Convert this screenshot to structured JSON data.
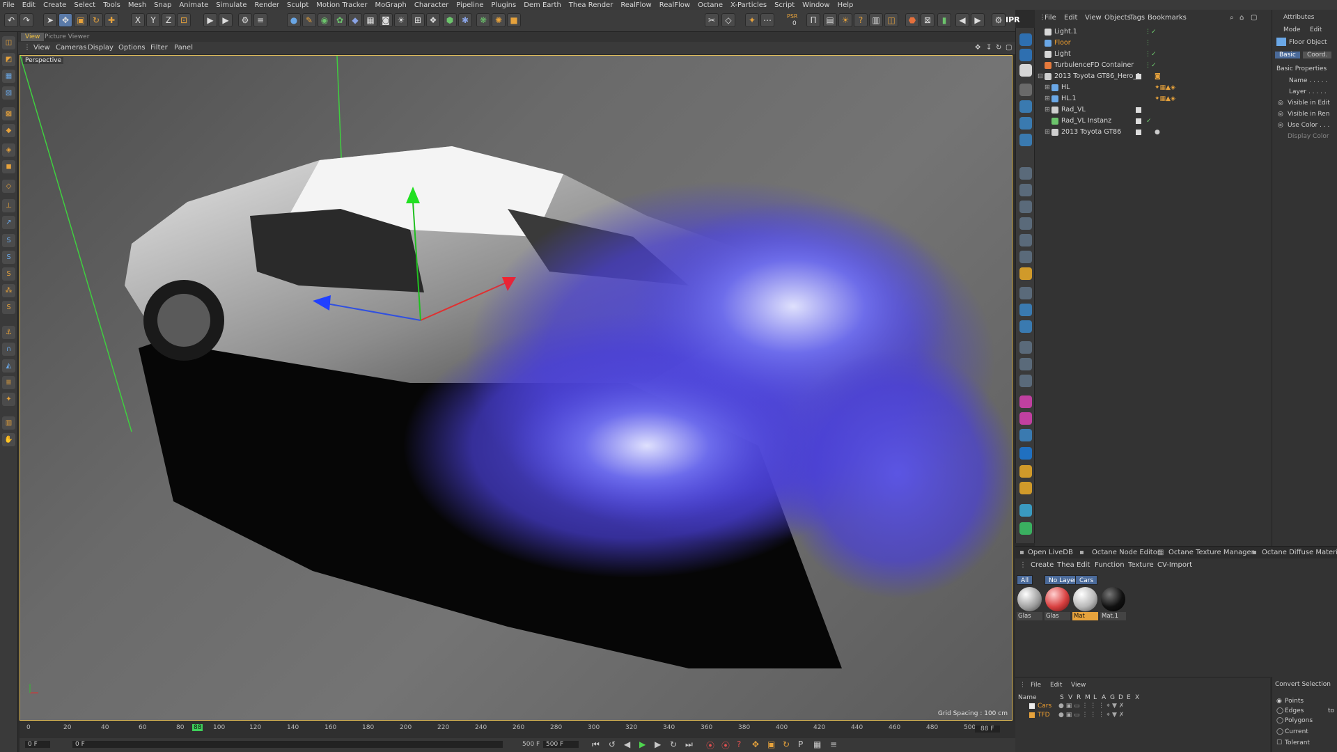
{
  "menu": [
    "File",
    "Edit",
    "Create",
    "Select",
    "Tools",
    "Mesh",
    "Snap",
    "Animate",
    "Simulate",
    "Render",
    "Sculpt",
    "Motion Tracker",
    "MoGraph",
    "Character",
    "Pipeline",
    "Plugins",
    "Dem Earth",
    "Thea Render",
    "RealFlow",
    "RealFlow",
    "Octane",
    "X-Particles",
    "Script",
    "Window",
    "Help"
  ],
  "toolbar": {
    "axis_x": "X",
    "axis_y": "Y",
    "axis_z": "Z",
    "psr_label": "PSR",
    "psr_value": "0",
    "ipr_label": "IPR"
  },
  "viewport": {
    "tab_view": "View",
    "tab_picture_viewer": "Picture Viewer",
    "menu": [
      "View",
      "Cameras",
      "Display",
      "Options",
      "Filter",
      "Panel"
    ],
    "camera_label": "Perspective",
    "grid_spacing": "Grid Spacing : 100 cm"
  },
  "timeline": {
    "ticks": [
      "0",
      "20",
      "40",
      "60",
      "80",
      "88",
      "100",
      "120",
      "140",
      "160",
      "180",
      "200",
      "220",
      "240",
      "260",
      "280",
      "300",
      "320",
      "340",
      "360",
      "380",
      "400",
      "420",
      "440",
      "460",
      "480",
      "500"
    ],
    "current_frame_display": "88 F",
    "start_field": "0 F",
    "start_field2": "0 F",
    "end_field": "500 F",
    "end_field2": "500 F"
  },
  "object_manager": {
    "menu": [
      "File",
      "Edit",
      "View",
      "Objects",
      "Tags",
      "Bookmarks"
    ],
    "objects": [
      {
        "name": "Light.1",
        "color": "#cfcfcf"
      },
      {
        "name": "Floor",
        "color": "#f0a030"
      },
      {
        "name": "Light",
        "color": "#cfcfcf"
      },
      {
        "name": "TurbulenceFD Container",
        "color": "#cfcfcf"
      },
      {
        "name": "2013 Toyota GT86_Hero_1",
        "color": "#cfcfcf"
      },
      {
        "name": "HL",
        "color": "#cfcfcf"
      },
      {
        "name": "HL.1",
        "color": "#cfcfcf"
      },
      {
        "name": "Rad_VL",
        "color": "#cfcfcf"
      },
      {
        "name": "Rad_VL Instanz",
        "color": "#cfcfcf"
      },
      {
        "name": "2013 Toyota GT86",
        "color": "#cfcfcf"
      }
    ]
  },
  "attributes": {
    "title": "Attributes",
    "mode": "Mode",
    "edit": "Edit",
    "object_name": "Floor Object",
    "tab_basic": "Basic",
    "tab_coord": "Coord.",
    "section": "Basic Properties",
    "fields": [
      "Name . . . . .",
      "Layer . . . . .",
      "Visible in Edit",
      "Visible in Ren",
      "Use Color . . .",
      "Display Color"
    ]
  },
  "panel_tabs": [
    "Open LiveDB",
    "Octane Node Editor",
    "Octane Texture Manager",
    "Octane Diffuse Material"
  ],
  "material_manager": {
    "menu": [
      "Create",
      "Thea",
      "Edit",
      "Function",
      "Texture",
      "CV-Import"
    ],
    "filters": [
      "All",
      "No Layer",
      "Cars"
    ],
    "materials": [
      {
        "name": "Glas",
        "color": "#d8d8d8"
      },
      {
        "name": "Glas",
        "color": "#d84040"
      },
      {
        "name": "Mat",
        "color": "#e8e8e8"
      },
      {
        "name": "Mat.1",
        "color": "#111111"
      }
    ]
  },
  "layer_manager": {
    "menu": [
      "File",
      "Edit",
      "View"
    ],
    "header_name": "Name",
    "header_cols": [
      "S",
      "V",
      "R",
      "M",
      "L",
      "A",
      "G",
      "D",
      "E",
      "X"
    ],
    "layers": [
      {
        "name": "Cars",
        "color": "#f0a030"
      },
      {
        "name": "TFD",
        "color": "#f0a030"
      }
    ]
  },
  "convert": {
    "title": "Convert Selection",
    "options": [
      "Points",
      "Edges",
      "Polygons",
      "Current",
      "Tolerant"
    ],
    "to": "to"
  }
}
